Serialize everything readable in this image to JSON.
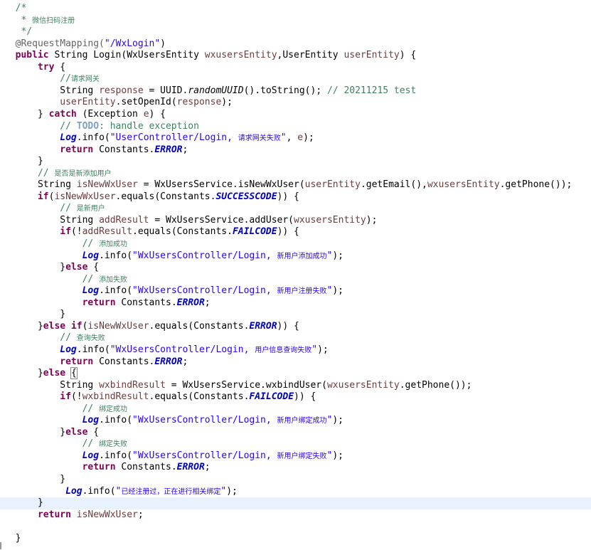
{
  "editor": {
    "language": "Java",
    "lines": [
      [
        {
          "t": "  /*",
          "c": "cm"
        }
      ],
      [
        {
          "t": "   * ",
          "c": "cm"
        },
        {
          "t": "微信扫码注册",
          "c": "cm cjk"
        }
      ],
      [
        {
          "t": "   */",
          "c": "cm"
        }
      ],
      [
        {
          "t": "  @RequestMapping(",
          "c": "ann"
        },
        {
          "t": "\"/WxLogin\"",
          "c": "str"
        },
        {
          "t": ")",
          "c": ""
        }
      ],
      [
        {
          "t": "  ",
          "c": ""
        },
        {
          "t": "public",
          "c": "kw"
        },
        {
          "t": " String Login(WxUsersEntity ",
          "c": ""
        },
        {
          "t": "wxusersEntity",
          "c": "var"
        },
        {
          "t": ",UserEntity ",
          "c": ""
        },
        {
          "t": "userEntity",
          "c": "var"
        },
        {
          "t": ") {",
          "c": ""
        }
      ],
      [
        {
          "t": "      ",
          "c": ""
        },
        {
          "t": "try",
          "c": "kw"
        },
        {
          "t": " {",
          "c": ""
        }
      ],
      [
        {
          "t": "          //",
          "c": "cm"
        },
        {
          "t": "请求网关",
          "c": "cm cjk"
        }
      ],
      [
        {
          "t": "          String ",
          "c": ""
        },
        {
          "t": "response",
          "c": "var"
        },
        {
          "t": " = UUID.",
          "c": ""
        },
        {
          "t": "randomUUID",
          "c": "smi"
        },
        {
          "t": "().toString(); ",
          "c": ""
        },
        {
          "t": "// 20211215 test",
          "c": "cm"
        }
      ],
      [
        {
          "t": "          ",
          "c": ""
        },
        {
          "t": "userEntity",
          "c": "var"
        },
        {
          "t": ".setOpenId(",
          "c": ""
        },
        {
          "t": "response",
          "c": "var"
        },
        {
          "t": ");",
          "c": ""
        }
      ],
      [
        {
          "t": "      } ",
          "c": ""
        },
        {
          "t": "catch",
          "c": "kw"
        },
        {
          "t": " (Exception ",
          "c": ""
        },
        {
          "t": "e",
          "c": "var"
        },
        {
          "t": ") {",
          "c": ""
        }
      ],
      [
        {
          "t": "          // ",
          "c": "cm"
        },
        {
          "t": "TODO",
          "c": "todo"
        },
        {
          "t": ": handle exception",
          "c": "cm"
        }
      ],
      [
        {
          "t": "          ",
          "c": ""
        },
        {
          "t": "Log",
          "c": "fld"
        },
        {
          "t": ".info(",
          "c": ""
        },
        {
          "t": "\"UserController/Login, ",
          "c": "str"
        },
        {
          "t": "请求网关失败",
          "c": "str cjk"
        },
        {
          "t": "\"",
          "c": "str"
        },
        {
          "t": ", ",
          "c": ""
        },
        {
          "t": "e",
          "c": "var"
        },
        {
          "t": ");",
          "c": ""
        }
      ],
      [
        {
          "t": "          ",
          "c": ""
        },
        {
          "t": "return",
          "c": "kw"
        },
        {
          "t": " Constants.",
          "c": ""
        },
        {
          "t": "ERROR",
          "c": "fld"
        },
        {
          "t": ";",
          "c": ""
        }
      ],
      [
        {
          "t": "      }",
          "c": ""
        }
      ],
      [
        {
          "t": "      // ",
          "c": "cm"
        },
        {
          "t": "是否是新添加用户",
          "c": "cm cjk"
        }
      ],
      [
        {
          "t": "      String ",
          "c": ""
        },
        {
          "t": "isNewWxUser",
          "c": "var"
        },
        {
          "t": " = WxUsersService.isNewWxUser(",
          "c": ""
        },
        {
          "t": "userEntity",
          "c": "var"
        },
        {
          "t": ".getEmail(),",
          "c": ""
        },
        {
          "t": "wxusersEntity",
          "c": "var"
        },
        {
          "t": ".getPhone());",
          "c": ""
        }
      ],
      [
        {
          "t": "      ",
          "c": ""
        },
        {
          "t": "if",
          "c": "kw"
        },
        {
          "t": "(",
          "c": ""
        },
        {
          "t": "isNewWxUser",
          "c": "var"
        },
        {
          "t": ".equals(Constants.",
          "c": ""
        },
        {
          "t": "SUCCESSCODE",
          "c": "fld"
        },
        {
          "t": ")) {",
          "c": ""
        }
      ],
      [
        {
          "t": "          // ",
          "c": "cm"
        },
        {
          "t": "是新用户",
          "c": "cm cjk"
        }
      ],
      [
        {
          "t": "          String ",
          "c": ""
        },
        {
          "t": "addResult",
          "c": "var"
        },
        {
          "t": " = WxUsersService.addUser(",
          "c": ""
        },
        {
          "t": "wxusersEntity",
          "c": "var"
        },
        {
          "t": ");",
          "c": ""
        }
      ],
      [
        {
          "t": "          ",
          "c": ""
        },
        {
          "t": "if",
          "c": "kw"
        },
        {
          "t": "(!",
          "c": ""
        },
        {
          "t": "addResult",
          "c": "var"
        },
        {
          "t": ".equals(Constants.",
          "c": ""
        },
        {
          "t": "FAILCODE",
          "c": "fld"
        },
        {
          "t": ")) {",
          "c": ""
        }
      ],
      [
        {
          "t": "              // ",
          "c": "cm"
        },
        {
          "t": "添加成功",
          "c": "cm cjk"
        }
      ],
      [
        {
          "t": "              ",
          "c": ""
        },
        {
          "t": "Log",
          "c": "fld"
        },
        {
          "t": ".info(",
          "c": ""
        },
        {
          "t": "\"WxUsersController/Login, ",
          "c": "str"
        },
        {
          "t": "新用户添加成功",
          "c": "str cjk"
        },
        {
          "t": "\"",
          "c": "str"
        },
        {
          "t": ");",
          "c": ""
        }
      ],
      [
        {
          "t": "          }",
          "c": ""
        },
        {
          "t": "else",
          "c": "kw"
        },
        {
          "t": " {",
          "c": ""
        }
      ],
      [
        {
          "t": "              // ",
          "c": "cm"
        },
        {
          "t": "添加失败",
          "c": "cm cjk"
        }
      ],
      [
        {
          "t": "              ",
          "c": ""
        },
        {
          "t": "Log",
          "c": "fld"
        },
        {
          "t": ".info(",
          "c": ""
        },
        {
          "t": "\"WxUsersController/Login, ",
          "c": "str"
        },
        {
          "t": "新用户注册失败",
          "c": "str cjk"
        },
        {
          "t": "\"",
          "c": "str"
        },
        {
          "t": ");",
          "c": ""
        }
      ],
      [
        {
          "t": "              ",
          "c": ""
        },
        {
          "t": "return",
          "c": "kw"
        },
        {
          "t": " Constants.",
          "c": ""
        },
        {
          "t": "ERROR",
          "c": "fld"
        },
        {
          "t": ";",
          "c": ""
        }
      ],
      [
        {
          "t": "          }",
          "c": ""
        }
      ],
      [
        {
          "t": "      }",
          "c": ""
        },
        {
          "t": "else if",
          "c": "kw"
        },
        {
          "t": "(",
          "c": ""
        },
        {
          "t": "isNewWxUser",
          "c": "var"
        },
        {
          "t": ".equals(Constants.",
          "c": ""
        },
        {
          "t": "ERROR",
          "c": "fld"
        },
        {
          "t": ")) {",
          "c": ""
        }
      ],
      [
        {
          "t": "          // ",
          "c": "cm"
        },
        {
          "t": "查询失败",
          "c": "cm cjk"
        }
      ],
      [
        {
          "t": "          ",
          "c": ""
        },
        {
          "t": "Log",
          "c": "fld"
        },
        {
          "t": ".info(",
          "c": ""
        },
        {
          "t": "\"WxUsersController/Login, ",
          "c": "str"
        },
        {
          "t": "用户信息查询失败",
          "c": "str cjk"
        },
        {
          "t": "\"",
          "c": "str"
        },
        {
          "t": ");",
          "c": ""
        }
      ],
      [
        {
          "t": "          ",
          "c": ""
        },
        {
          "t": "return",
          "c": "kw"
        },
        {
          "t": " Constants.",
          "c": ""
        },
        {
          "t": "ERROR",
          "c": "fld"
        },
        {
          "t": ";",
          "c": ""
        }
      ],
      [
        {
          "t": "      }",
          "c": ""
        },
        {
          "t": "else",
          "c": "kw"
        },
        {
          "t": " ",
          "c": ""
        },
        {
          "t": "{",
          "c": "bracket-box"
        }
      ],
      [
        {
          "t": "          String ",
          "c": ""
        },
        {
          "t": "wxbindResult",
          "c": "var"
        },
        {
          "t": " = WxUsersService.wxbindUser(",
          "c": ""
        },
        {
          "t": "wxusersEntity",
          "c": "var"
        },
        {
          "t": ".getPhone());",
          "c": ""
        }
      ],
      [
        {
          "t": "          ",
          "c": ""
        },
        {
          "t": "if",
          "c": "kw"
        },
        {
          "t": "(!",
          "c": ""
        },
        {
          "t": "wxbindResult",
          "c": "var"
        },
        {
          "t": ".equals(Constants.",
          "c": ""
        },
        {
          "t": "FAILCODE",
          "c": "fld"
        },
        {
          "t": ")) {",
          "c": ""
        }
      ],
      [
        {
          "t": "              // ",
          "c": "cm"
        },
        {
          "t": "绑定成功",
          "c": "cm cjk"
        }
      ],
      [
        {
          "t": "              ",
          "c": ""
        },
        {
          "t": "Log",
          "c": "fld"
        },
        {
          "t": ".info(",
          "c": ""
        },
        {
          "t": "\"WxUsersController/Login, ",
          "c": "str"
        },
        {
          "t": "新用户绑定成功",
          "c": "str cjk"
        },
        {
          "t": "\"",
          "c": "str"
        },
        {
          "t": ");",
          "c": ""
        }
      ],
      [
        {
          "t": "          }",
          "c": ""
        },
        {
          "t": "else",
          "c": "kw"
        },
        {
          "t": " {",
          "c": ""
        }
      ],
      [
        {
          "t": "              // ",
          "c": "cm"
        },
        {
          "t": "绑定失败",
          "c": "cm cjk"
        }
      ],
      [
        {
          "t": "              ",
          "c": ""
        },
        {
          "t": "Log",
          "c": "fld"
        },
        {
          "t": ".info(",
          "c": ""
        },
        {
          "t": "\"WxUsersController/Login, ",
          "c": "str"
        },
        {
          "t": "新用户绑定失败",
          "c": "str cjk"
        },
        {
          "t": "\"",
          "c": "str"
        },
        {
          "t": ");",
          "c": ""
        }
      ],
      [
        {
          "t": "              ",
          "c": ""
        },
        {
          "t": "return",
          "c": "kw"
        },
        {
          "t": " Constants.",
          "c": ""
        },
        {
          "t": "ERROR",
          "c": "fld"
        },
        {
          "t": ";",
          "c": ""
        }
      ],
      [
        {
          "t": "          }",
          "c": ""
        }
      ],
      [
        {
          "t": "           ",
          "c": ""
        },
        {
          "t": "Log",
          "c": "fld"
        },
        {
          "t": ".info(",
          "c": ""
        },
        {
          "t": "\"",
          "c": "str"
        },
        {
          "t": "已经注册过，正在进行相关绑定",
          "c": "str cjk"
        },
        {
          "t": "\"",
          "c": "str"
        },
        {
          "t": ");",
          "c": ""
        }
      ],
      [
        {
          "t": "      }",
          "c": ""
        }
      ],
      [
        {
          "t": "      ",
          "c": ""
        },
        {
          "t": "return",
          "c": "kw"
        },
        {
          "t": " ",
          "c": ""
        },
        {
          "t": "isNewWxUser",
          "c": "var"
        },
        {
          "t": ";",
          "c": ""
        }
      ],
      [
        {
          "t": "",
          "c": ""
        }
      ],
      [
        {
          "t": "  }",
          "c": ""
        }
      ]
    ],
    "current_line_index": 42
  }
}
